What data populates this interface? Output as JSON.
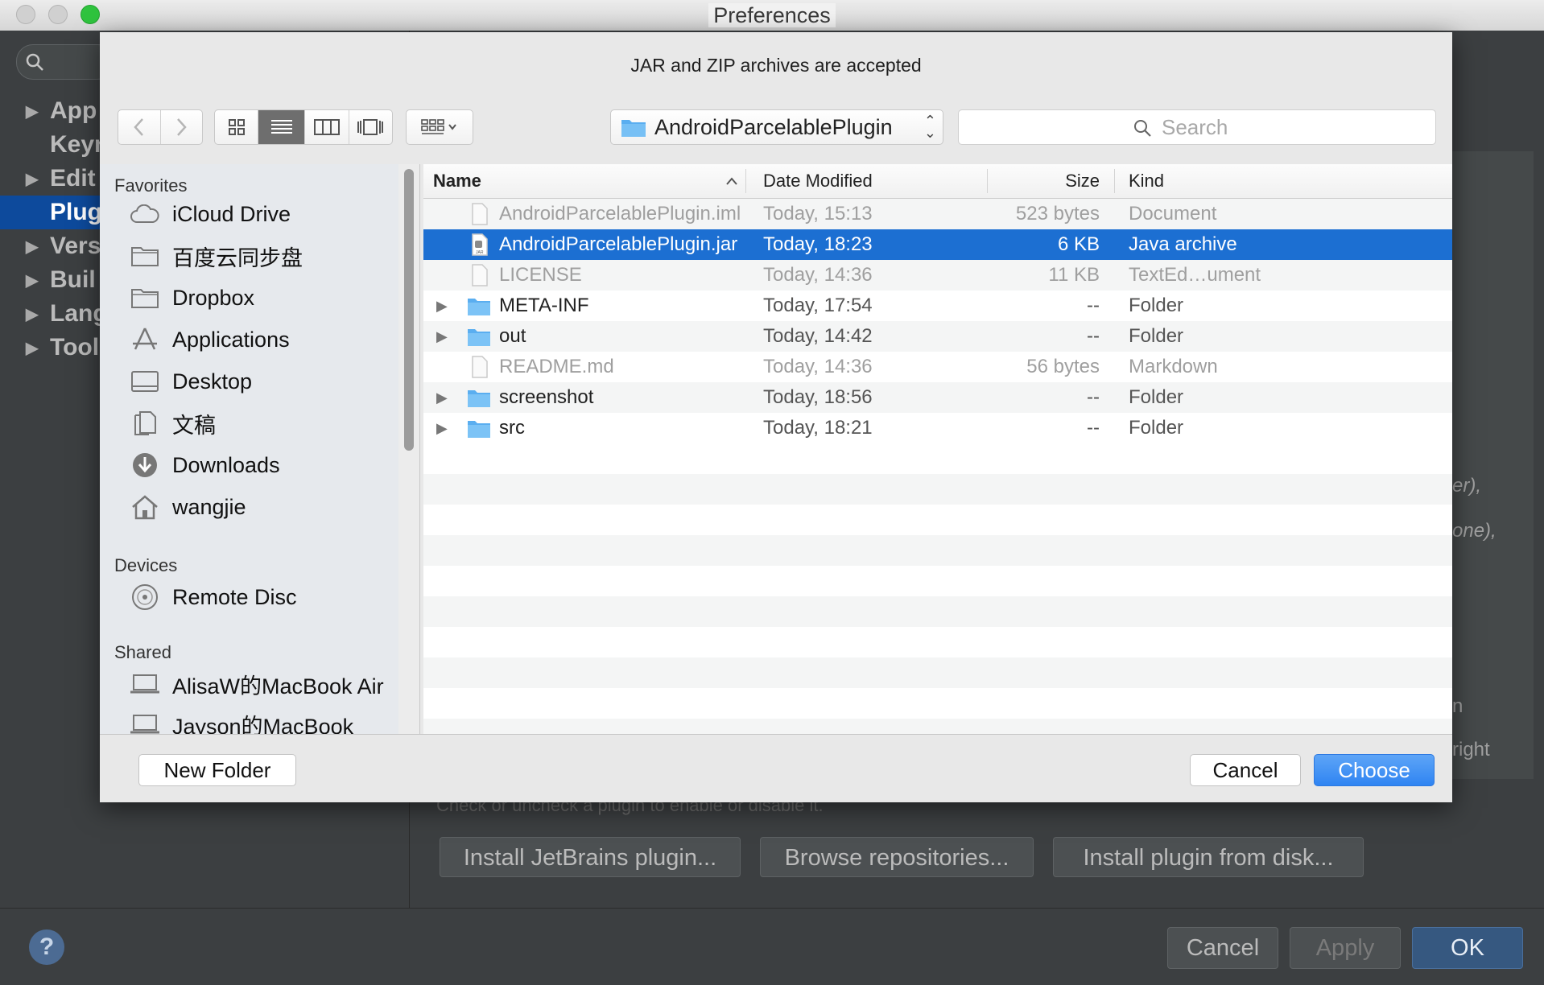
{
  "window": {
    "title": "Preferences"
  },
  "ide": {
    "tree": [
      {
        "label": "App",
        "expandable": true
      },
      {
        "label": "Keyr",
        "expandable": false
      },
      {
        "label": "Edit",
        "expandable": true
      },
      {
        "label": "Plug",
        "expandable": false,
        "selected": true
      },
      {
        "label": "Vers",
        "expandable": true
      },
      {
        "label": "Buil",
        "expandable": true
      },
      {
        "label": "Lang",
        "expandable": true
      },
      {
        "label": "Tool",
        "expandable": true
      }
    ],
    "fragments": {
      "a": "er),",
      "b": "one),",
      "c": "n",
      "d": "right"
    },
    "hint": "Check or uncheck a plugin to enable or disable it.",
    "buttons": {
      "install_jetbrains": "Install JetBrains plugin...",
      "browse_repos": "Browse repositories...",
      "install_disk": "Install plugin from disk..."
    },
    "footer": {
      "help": "?",
      "cancel": "Cancel",
      "apply": "Apply",
      "ok": "OK"
    }
  },
  "dialog": {
    "message": "JAR and ZIP archives are accepted",
    "location": "AndroidParcelablePlugin",
    "search_placeholder": "Search",
    "sidebar": {
      "favorites_header": "Favorites",
      "favorites": [
        {
          "label": "iCloud Drive",
          "icon": "cloud-icon"
        },
        {
          "label": "百度云同步盘",
          "icon": "folder-icon"
        },
        {
          "label": "Dropbox",
          "icon": "folder-icon"
        },
        {
          "label": "Applications",
          "icon": "applications-icon"
        },
        {
          "label": "Desktop",
          "icon": "desktop-icon"
        },
        {
          "label": "文稿",
          "icon": "document-icon"
        },
        {
          "label": "Downloads",
          "icon": "downloads-icon"
        },
        {
          "label": "wangjie",
          "icon": "home-icon"
        }
      ],
      "devices_header": "Devices",
      "devices": [
        {
          "label": "Remote Disc",
          "icon": "disc-icon"
        }
      ],
      "shared_header": "Shared",
      "shared": [
        {
          "label": "AlisaW的MacBook Air",
          "icon": "laptop-icon"
        },
        {
          "label": "Jayson的MacBook",
          "icon": "laptop-icon"
        }
      ]
    },
    "columns": {
      "name": "Name",
      "date": "Date Modified",
      "size": "Size",
      "kind": "Kind"
    },
    "files": [
      {
        "name": "AndroidParcelablePlugin.iml",
        "date": "Today, 15:13",
        "size": "523 bytes",
        "kind": "Document",
        "type": "file",
        "enabled": false,
        "selected": false
      },
      {
        "name": "AndroidParcelablePlugin.jar",
        "date": "Today, 18:23",
        "size": "6 KB",
        "kind": "Java archive",
        "type": "jar",
        "enabled": true,
        "selected": true
      },
      {
        "name": "LICENSE",
        "date": "Today, 14:36",
        "size": "11 KB",
        "kind": "TextEd…ument",
        "type": "file",
        "enabled": false,
        "selected": false
      },
      {
        "name": "META-INF",
        "date": "Today, 17:54",
        "size": "--",
        "kind": "Folder",
        "type": "folder",
        "enabled": true,
        "selected": false
      },
      {
        "name": "out",
        "date": "Today, 14:42",
        "size": "--",
        "kind": "Folder",
        "type": "folder",
        "enabled": true,
        "selected": false
      },
      {
        "name": "README.md",
        "date": "Today, 14:36",
        "size": "56 bytes",
        "kind": "Markdown",
        "type": "file",
        "enabled": false,
        "selected": false
      },
      {
        "name": "screenshot",
        "date": "Today, 18:56",
        "size": "--",
        "kind": "Folder",
        "type": "folder",
        "enabled": true,
        "selected": false
      },
      {
        "name": "src",
        "date": "Today, 18:21",
        "size": "--",
        "kind": "Folder",
        "type": "folder",
        "enabled": true,
        "selected": false
      }
    ],
    "buttons": {
      "new_folder": "New Folder",
      "cancel": "Cancel",
      "choose": "Choose"
    }
  }
}
